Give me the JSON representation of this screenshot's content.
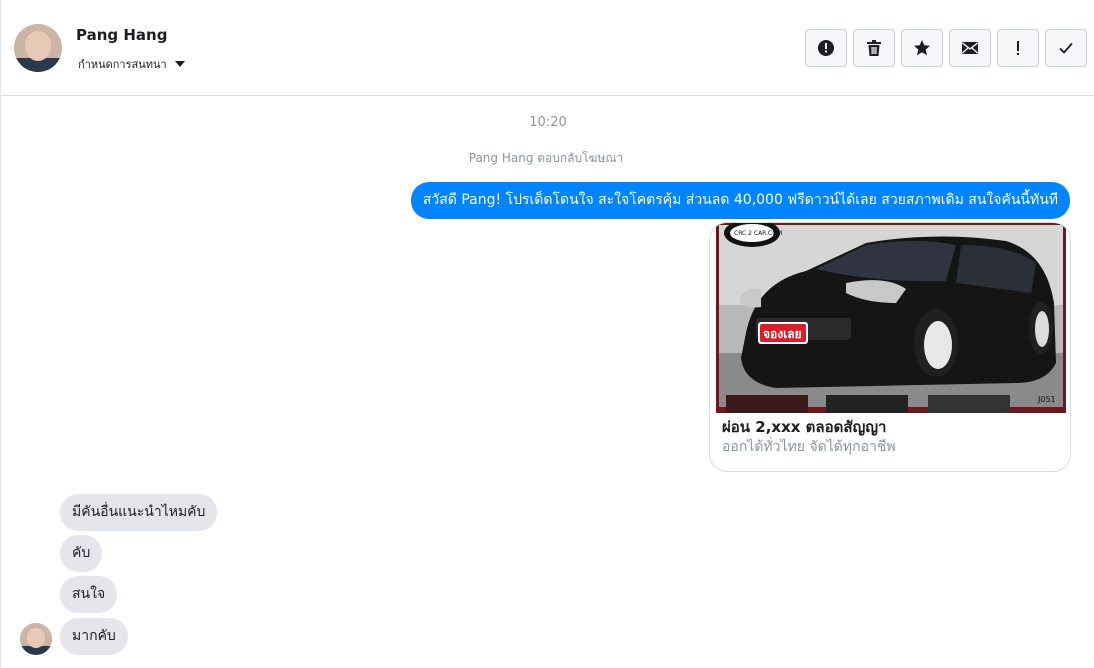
{
  "header": {
    "contact_name": "Pang Hang",
    "assign_label": "กำหนดการสนทนา",
    "actions": [
      {
        "name": "report-spam-button",
        "icon": "alert-circle-icon"
      },
      {
        "name": "delete-button",
        "icon": "trash-icon"
      },
      {
        "name": "star-button",
        "icon": "star-icon"
      },
      {
        "name": "mark-unread-button",
        "icon": "envelope-icon"
      },
      {
        "name": "follow-up-button",
        "icon": "exclamation-icon"
      },
      {
        "name": "mark-done-button",
        "icon": "check-icon"
      }
    ]
  },
  "conversation": {
    "timestamp": "10:20",
    "replied_note": "Pang Hang ตอบกลับโฆษณา",
    "outgoing_message": "สวัสดี Pang! โปรเด็ดโดนใจ สะใจโคตรคุ้ม ส่วนลด 40,000 ฟรีดาวน์ได้เลย สวยสภาพเดิม สนใจคันนี้ทันที",
    "ad": {
      "badge_text": "CRC 2 CAR.COM",
      "sticker_text": "จองเลย",
      "code": "J051",
      "title": "ผ่อน 2,xxx ตลอดสัญญา",
      "subtitle": "ออกได้ทั่วไทย จัดได้ทุกอาชีพ"
    },
    "incoming_messages": [
      "มีคันอื่นแนะนำไหมคับ",
      "คับ",
      "สนใจ",
      "มากคับ"
    ]
  },
  "colors": {
    "accent": "#0084ff",
    "incoming_bubble": "#e4e6eb",
    "muted_text": "#8d949e",
    "ad_frame": "#6a1a1e"
  }
}
